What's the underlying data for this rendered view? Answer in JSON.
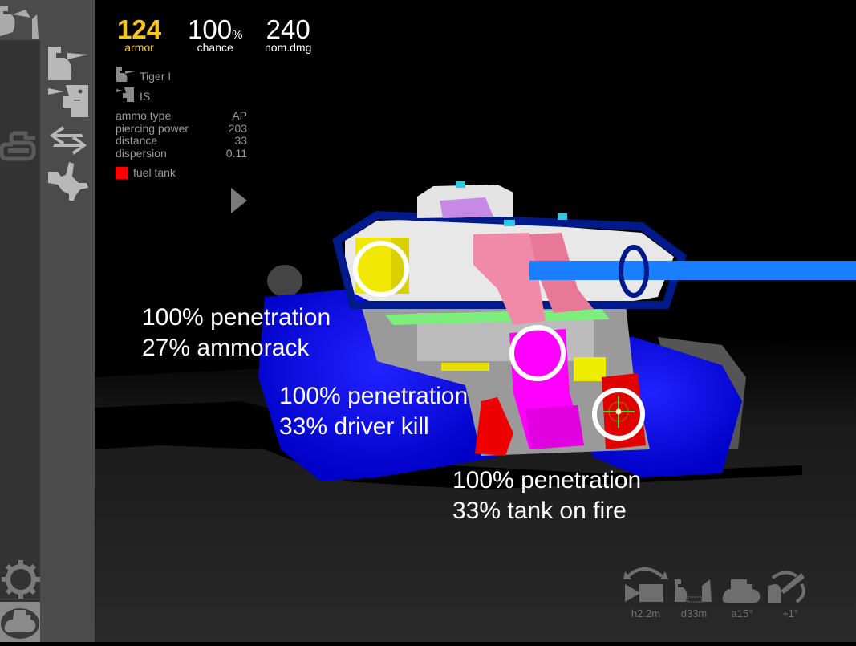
{
  "hud": {
    "armor": {
      "value": "124",
      "label": "armor"
    },
    "chance": {
      "value": "100",
      "unit": "%",
      "label": "chance"
    },
    "nom_dmg": {
      "value": "240",
      "label": "nom.dmg"
    }
  },
  "attacker_tank": {
    "name": "Tiger I",
    "icon": "attacker-tank-icon"
  },
  "target_tank": {
    "name": "IS",
    "icon": "target-tank-icon"
  },
  "shot_params": [
    {
      "label": "ammo type",
      "value": "AP"
    },
    {
      "label": "piercing power",
      "value": "203"
    },
    {
      "label": "distance",
      "value": "33"
    },
    {
      "label": "dispersion",
      "value": "0.11"
    }
  ],
  "legend": {
    "label": "fuel tank",
    "color": "#ff0000"
  },
  "annotations": [
    {
      "line1": "100% penetration",
      "line2": "27% ammorack"
    },
    {
      "line1": "100% penetration",
      "line2": "33% driver kill"
    },
    {
      "line1": "100% penetration",
      "line2": "33% tank on fire"
    }
  ],
  "bottom_tools": [
    {
      "label": "h2.2m",
      "icon": "camera-height-icon"
    },
    {
      "label": "d33m",
      "icon": "distance-icon"
    },
    {
      "label": "a15°",
      "icon": "tank-angle-icon"
    },
    {
      "label": "+1°",
      "icon": "gun-angle-icon"
    }
  ],
  "sidebar": {
    "items": [
      {
        "name": "shooter-target-mode",
        "icon": "tank-vs-tank-icon"
      },
      {
        "name": "select-attacker",
        "icon": "attacker-tank-icon"
      },
      {
        "name": "select-target",
        "icon": "target-tank-icon"
      },
      {
        "name": "swap-tanks",
        "icon": "swap-arrows-icon"
      },
      {
        "name": "module-view",
        "icon": "tank-outline-icon"
      },
      {
        "name": "modules",
        "icon": "gear-segment-icon"
      },
      {
        "name": "settings",
        "icon": "gear-icon"
      },
      {
        "name": "garage",
        "icon": "tank-badge-icon"
      }
    ]
  },
  "colors": {
    "accent": "#f6c51b",
    "hull": "#0000ee",
    "gun": "#1a7fff",
    "fuel_tank": "#ff0000",
    "ammorack": "#ffff00",
    "driver": "#ff00ff",
    "crew": "#f07a9a",
    "turret_ring": "#66ee66"
  }
}
